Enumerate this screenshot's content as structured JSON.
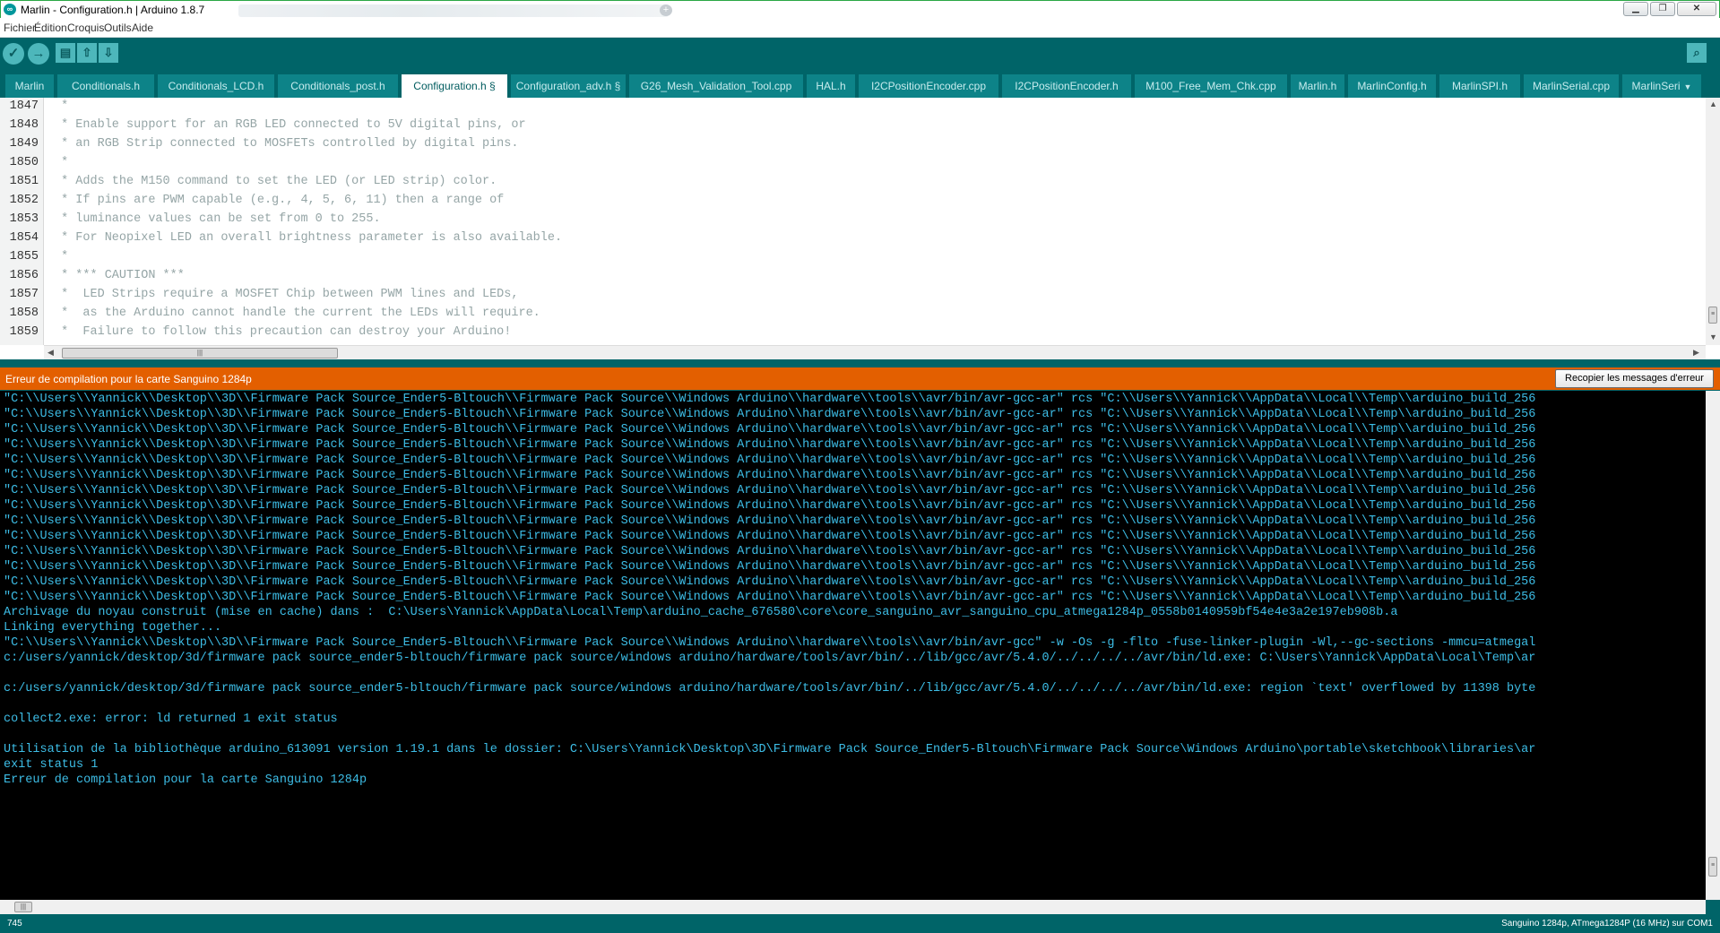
{
  "window": {
    "title": "Marlin - Configuration.h | Arduino 1.8.7"
  },
  "menu": [
    "Fichier",
    "Édition",
    "Croquis",
    "Outils",
    "Aide"
  ],
  "tabs": [
    "Marlin",
    "Conditionals.h",
    "Conditionals_LCD.h",
    "Conditionals_post.h",
    "Configuration.h §",
    "Configuration_adv.h §",
    "G26_Mesh_Validation_Tool.cpp",
    "HAL.h",
    "I2CPositionEncoder.cpp",
    "I2CPositionEncoder.h",
    "M100_Free_Mem_Chk.cpp",
    "Marlin.h",
    "MarlinConfig.h",
    "MarlinSPI.h",
    "MarlinSerial.cpp",
    "MarlinSeri"
  ],
  "active_tab_index": 4,
  "editor": {
    "line_numbers": [
      "1847",
      "1848",
      "1849",
      "1850",
      "1851",
      "1852",
      "1853",
      "1854",
      "1855",
      "1856",
      "1857",
      "1858",
      "1859"
    ],
    "lines": [
      " *",
      " * Enable support for an RGB LED connected to 5V digital pins, or",
      " * an RGB Strip connected to MOSFETs controlled by digital pins.",
      " *",
      " * Adds the M150 command to set the LED (or LED strip) color.",
      " * If pins are PWM capable (e.g., 4, 5, 6, 11) then a range of",
      " * luminance values can be set from 0 to 255.",
      " * For Neopixel LED an overall brightness parameter is also available.",
      " *",
      " * *** CAUTION ***",
      " *  LED Strips require a MOSFET Chip between PWM lines and LEDs,",
      " *  as the Arduino cannot handle the current the LEDs will require.",
      " *  Failure to follow this precaution can destroy your Arduino!"
    ]
  },
  "status": {
    "message": "Erreur de compilation pour la carte Sanguino 1284p",
    "copy_button": "Recopier les messages d'erreur"
  },
  "console": {
    "lines": [
      "\"C:\\\\Users\\\\Yannick\\\\Desktop\\\\3D\\\\Firmware Pack Source_Ender5-Bltouch\\\\Firmware Pack Source\\\\Windows Arduino\\\\hardware\\\\tools\\\\avr/bin/avr-gcc-ar\" rcs \"C:\\\\Users\\\\Yannick\\\\AppData\\\\Local\\\\Temp\\\\arduino_build_256",
      "\"C:\\\\Users\\\\Yannick\\\\Desktop\\\\3D\\\\Firmware Pack Source_Ender5-Bltouch\\\\Firmware Pack Source\\\\Windows Arduino\\\\hardware\\\\tools\\\\avr/bin/avr-gcc-ar\" rcs \"C:\\\\Users\\\\Yannick\\\\AppData\\\\Local\\\\Temp\\\\arduino_build_256",
      "\"C:\\\\Users\\\\Yannick\\\\Desktop\\\\3D\\\\Firmware Pack Source_Ender5-Bltouch\\\\Firmware Pack Source\\\\Windows Arduino\\\\hardware\\\\tools\\\\avr/bin/avr-gcc-ar\" rcs \"C:\\\\Users\\\\Yannick\\\\AppData\\\\Local\\\\Temp\\\\arduino_build_256",
      "\"C:\\\\Users\\\\Yannick\\\\Desktop\\\\3D\\\\Firmware Pack Source_Ender5-Bltouch\\\\Firmware Pack Source\\\\Windows Arduino\\\\hardware\\\\tools\\\\avr/bin/avr-gcc-ar\" rcs \"C:\\\\Users\\\\Yannick\\\\AppData\\\\Local\\\\Temp\\\\arduino_build_256",
      "\"C:\\\\Users\\\\Yannick\\\\Desktop\\\\3D\\\\Firmware Pack Source_Ender5-Bltouch\\\\Firmware Pack Source\\\\Windows Arduino\\\\hardware\\\\tools\\\\avr/bin/avr-gcc-ar\" rcs \"C:\\\\Users\\\\Yannick\\\\AppData\\\\Local\\\\Temp\\\\arduino_build_256",
      "\"C:\\\\Users\\\\Yannick\\\\Desktop\\\\3D\\\\Firmware Pack Source_Ender5-Bltouch\\\\Firmware Pack Source\\\\Windows Arduino\\\\hardware\\\\tools\\\\avr/bin/avr-gcc-ar\" rcs \"C:\\\\Users\\\\Yannick\\\\AppData\\\\Local\\\\Temp\\\\arduino_build_256",
      "\"C:\\\\Users\\\\Yannick\\\\Desktop\\\\3D\\\\Firmware Pack Source_Ender5-Bltouch\\\\Firmware Pack Source\\\\Windows Arduino\\\\hardware\\\\tools\\\\avr/bin/avr-gcc-ar\" rcs \"C:\\\\Users\\\\Yannick\\\\AppData\\\\Local\\\\Temp\\\\arduino_build_256",
      "\"C:\\\\Users\\\\Yannick\\\\Desktop\\\\3D\\\\Firmware Pack Source_Ender5-Bltouch\\\\Firmware Pack Source\\\\Windows Arduino\\\\hardware\\\\tools\\\\avr/bin/avr-gcc-ar\" rcs \"C:\\\\Users\\\\Yannick\\\\AppData\\\\Local\\\\Temp\\\\arduino_build_256",
      "\"C:\\\\Users\\\\Yannick\\\\Desktop\\\\3D\\\\Firmware Pack Source_Ender5-Bltouch\\\\Firmware Pack Source\\\\Windows Arduino\\\\hardware\\\\tools\\\\avr/bin/avr-gcc-ar\" rcs \"C:\\\\Users\\\\Yannick\\\\AppData\\\\Local\\\\Temp\\\\arduino_build_256",
      "\"C:\\\\Users\\\\Yannick\\\\Desktop\\\\3D\\\\Firmware Pack Source_Ender5-Bltouch\\\\Firmware Pack Source\\\\Windows Arduino\\\\hardware\\\\tools\\\\avr/bin/avr-gcc-ar\" rcs \"C:\\\\Users\\\\Yannick\\\\AppData\\\\Local\\\\Temp\\\\arduino_build_256",
      "\"C:\\\\Users\\\\Yannick\\\\Desktop\\\\3D\\\\Firmware Pack Source_Ender5-Bltouch\\\\Firmware Pack Source\\\\Windows Arduino\\\\hardware\\\\tools\\\\avr/bin/avr-gcc-ar\" rcs \"C:\\\\Users\\\\Yannick\\\\AppData\\\\Local\\\\Temp\\\\arduino_build_256",
      "\"C:\\\\Users\\\\Yannick\\\\Desktop\\\\3D\\\\Firmware Pack Source_Ender5-Bltouch\\\\Firmware Pack Source\\\\Windows Arduino\\\\hardware\\\\tools\\\\avr/bin/avr-gcc-ar\" rcs \"C:\\\\Users\\\\Yannick\\\\AppData\\\\Local\\\\Temp\\\\arduino_build_256",
      "\"C:\\\\Users\\\\Yannick\\\\Desktop\\\\3D\\\\Firmware Pack Source_Ender5-Bltouch\\\\Firmware Pack Source\\\\Windows Arduino\\\\hardware\\\\tools\\\\avr/bin/avr-gcc-ar\" rcs \"C:\\\\Users\\\\Yannick\\\\AppData\\\\Local\\\\Temp\\\\arduino_build_256",
      "\"C:\\\\Users\\\\Yannick\\\\Desktop\\\\3D\\\\Firmware Pack Source_Ender5-Bltouch\\\\Firmware Pack Source\\\\Windows Arduino\\\\hardware\\\\tools\\\\avr/bin/avr-gcc-ar\" rcs \"C:\\\\Users\\\\Yannick\\\\AppData\\\\Local\\\\Temp\\\\arduino_build_256",
      "Archivage du noyau construit (mise en cache) dans :  C:\\Users\\Yannick\\AppData\\Local\\Temp\\arduino_cache_676580\\core\\core_sanguino_avr_sanguino_cpu_atmega1284p_0558b0140959bf54e4e3a2e197eb908b.a",
      "Linking everything together...",
      "\"C:\\\\Users\\\\Yannick\\\\Desktop\\\\3D\\\\Firmware Pack Source_Ender5-Bltouch\\\\Firmware Pack Source\\\\Windows Arduino\\\\hardware\\\\tools\\\\avr/bin/avr-gcc\" -w -Os -g -flto -fuse-linker-plugin -Wl,--gc-sections -mmcu=atmegal",
      "c:/users/yannick/desktop/3d/firmware pack source_ender5-bltouch/firmware pack source/windows arduino/hardware/tools/avr/bin/../lib/gcc/avr/5.4.0/../../../../avr/bin/ld.exe: C:\\Users\\Yannick\\AppData\\Local\\Temp\\ar",
      "",
      "c:/users/yannick/desktop/3d/firmware pack source_ender5-bltouch/firmware pack source/windows arduino/hardware/tools/avr/bin/../lib/gcc/avr/5.4.0/../../../../avr/bin/ld.exe: region `text' overflowed by 11398 byte",
      "",
      "collect2.exe: error: ld returned 1 exit status",
      "",
      "Utilisation de la bibliothèque arduino_613091 version 1.19.1 dans le dossier: C:\\Users\\Yannick\\Desktop\\3D\\Firmware Pack Source_Ender5-Bltouch\\Firmware Pack Source\\Windows Arduino\\portable\\sketchbook\\libraries\\ar",
      "exit status 1",
      "Erreur de compilation pour la carte Sanguino 1284p"
    ]
  },
  "footer": {
    "line_number": "745",
    "board": "Sanguino 1284p, ATmega1284P (16 MHz) sur COM1"
  },
  "colors": {
    "teal": "#006468",
    "tab": "#0d8388",
    "error_bar": "#e35f00",
    "console_text": "#3dbde6",
    "comment_text": "#95a5a6"
  }
}
